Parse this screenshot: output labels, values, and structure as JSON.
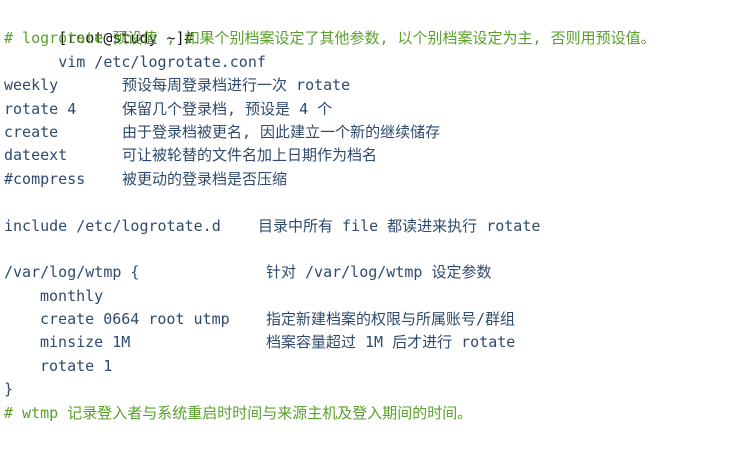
{
  "terminal": {
    "prompt": "[root@study ~]#",
    "command": "vim /etc/logrotate.conf",
    "header_comment": "# logrotate 预设值 , 如果个别档案设定了其他参数, 以个别档案设定为主, 否则用预设值。",
    "options": [
      {
        "key": "weekly",
        "desc": "预设每周登录档进行一次 rotate"
      },
      {
        "key": "rotate 4",
        "desc": "保留几个登录档, 预设是 4 个"
      },
      {
        "key": "create",
        "desc": "由于登录档被更名, 因此建立一个新的继续储存"
      },
      {
        "key": "dateext",
        "desc": "可让被轮替的文件名加上日期作为档名"
      },
      {
        "key": "#compress",
        "desc": "被更动的登录档是否压缩"
      }
    ],
    "include_line": "include /etc/logrotate.d",
    "include_desc": "目录中所有 file 都读进来执行 rotate",
    "block_open": "/var/log/wtmp {",
    "block_open_desc": "针对 /var/log/wtmp 设定参数",
    "block_items": [
      {
        "key": "monthly",
        "desc": ""
      },
      {
        "key": "create 0664 root utmp",
        "desc": "指定新建档案的权限与所属账号/群组"
      },
      {
        "key": "minsize 1M",
        "desc": "档案容量超过 1M 后才进行 rotate"
      },
      {
        "key": "rotate 1",
        "desc": ""
      }
    ],
    "block_close": "}",
    "footer_comment": "# wtmp 记录登入者与系统重启时时间与来源主机及登入期间的时间。"
  }
}
